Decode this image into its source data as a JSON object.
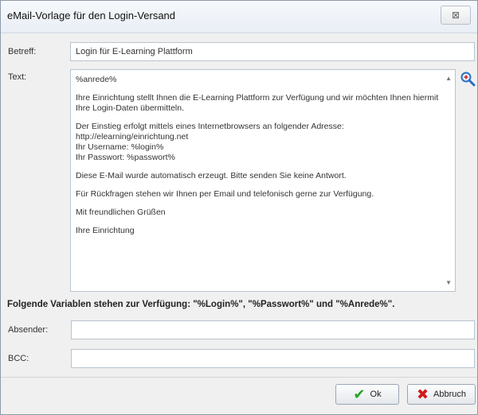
{
  "window": {
    "title": "eMail-Vorlage für den Login-Versand",
    "close_label": "⊠"
  },
  "form": {
    "subject_label": "Betreff:",
    "subject_value": "Login für E-Learning Plattform",
    "text_label": "Text:",
    "text_lines": [
      "%anrede%",
      "Ihre Einrichtung stellt Ihnen die E-Learning Plattform zur Verfügung und wir möchten Ihnen hiermit Ihre Login-Daten übermitteln.",
      "Der Einstieg erfolgt mittels eines Internetbrowsers an folgender Adresse:",
      "http://elearning/einrichtung.net",
      "Ihr Username: %login%",
      "Ihr Passwort: %passwort%",
      "Diese E-Mail wurde automatisch erzeugt. Bitte senden Sie keine Antwort.",
      "Für Rückfragen stehen wir Ihnen per Email und telefonisch gerne zur Verfügung.",
      "Mit freundlichen Grüßen",
      "Ihre Einrichtung"
    ],
    "variables_text": "Folgende Variablen stehen zur Verfügung: \"%Login%\", \"%Passwort%\" und \"%Anrede%\".",
    "sender_label": "Absender:",
    "sender_value": "",
    "bcc_label": "BCC:",
    "bcc_value": ""
  },
  "buttons": {
    "ok_label": "Ok",
    "cancel_label": "Abbruch"
  },
  "icons": {
    "zoom": "magnifier-icon",
    "ok": "checkmark-icon",
    "cancel": "cross-icon"
  },
  "colors": {
    "ok_check": "#2aa12a",
    "cancel_cross": "#d21a1a"
  }
}
